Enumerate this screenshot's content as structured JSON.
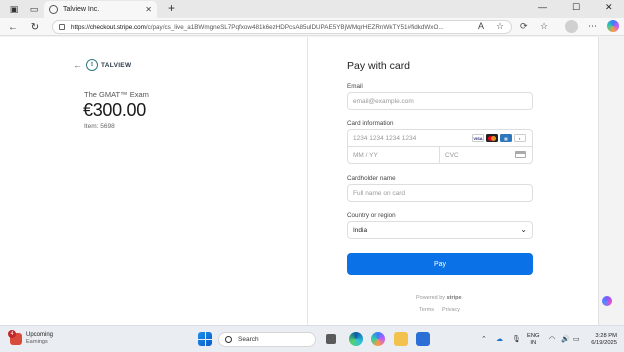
{
  "browser": {
    "tab_title": "Talview Inc.",
    "tab_close": "✕",
    "new_tab": "+",
    "url_host": "https://checkout.stripe.com",
    "url_path": "/c/pay/cs_live_a1BWmgneSL7Pqfxow481k6ezHDPcsA85ulDUPAE5YBjWMqrHEZRnWkTY51#fidkdWxO..."
  },
  "checkout": {
    "merchant_name": "TALVIEW",
    "product_name": "The GMAT™ Exam",
    "price": "€300.00",
    "item_id": "Item: 5698",
    "form_title": "Pay with card",
    "email_label": "Email",
    "email_placeholder": "email@example.com",
    "card_label": "Card information",
    "card_number_placeholder": "1234 1234 1234 1234",
    "expiry_placeholder": "MM / YY",
    "cvc_placeholder": "CVC",
    "card_brands": [
      "VISA",
      "Mastercard",
      "AMEX",
      "Discover"
    ],
    "cardholder_label": "Cardholder name",
    "cardholder_placeholder": "Full name on card",
    "country_label": "Country or region",
    "country_value": "India",
    "pay_label": "Pay",
    "powered_by": "Powered by",
    "powered_brand": "stripe",
    "terms_label": "Terms",
    "privacy_label": "Privacy"
  },
  "taskbar": {
    "weather_title": "Upcoming",
    "weather_sub": "Earnings",
    "weather_badge": "4",
    "search_label": "Search",
    "lang_line1": "ENG",
    "lang_line2": "IN",
    "time": "3:28 PM",
    "date": "6/19/2025"
  },
  "colors": {
    "pay_button": "#0a72e6",
    "brand_teal": "#2f7c7d"
  }
}
